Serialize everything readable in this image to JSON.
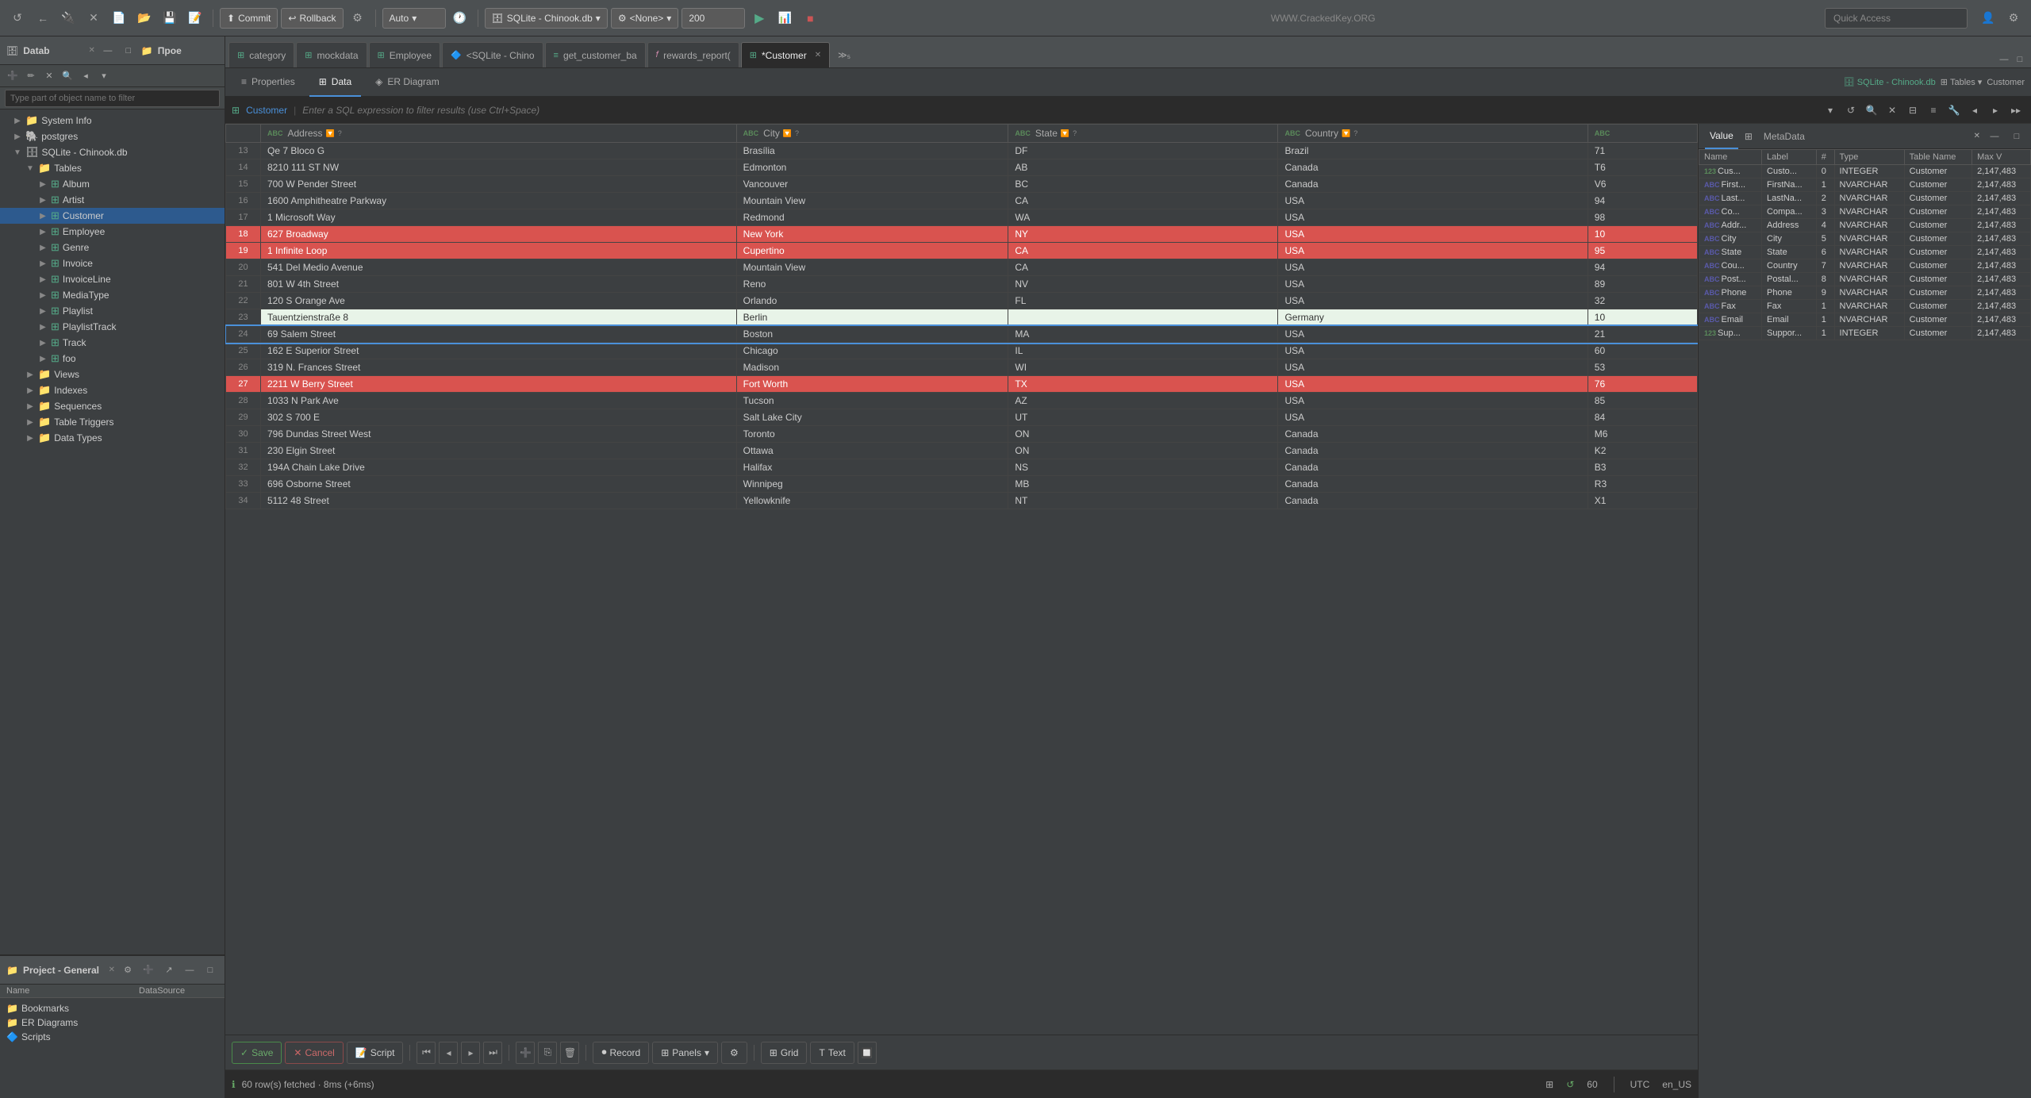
{
  "toolbar": {
    "commit_label": "Commit",
    "rollback_label": "Rollback",
    "auto_label": "Auto",
    "db_label": "SQLite - Chinook.db",
    "none_label": "<None>",
    "limit_value": "200",
    "quick_access_placeholder": "Quick Access",
    "url_text": "WWW.CrackedKey.ORG"
  },
  "sidebar": {
    "db_panel_title": "Datab",
    "proj_panel_title": "Прое",
    "filter_placeholder": "Type part of object name to filter",
    "tree_items": [
      {
        "label": "System Info",
        "indent": 1,
        "icon": "📁",
        "type": "folder"
      },
      {
        "label": "postgres",
        "indent": 1,
        "icon": "🐘",
        "type": "db"
      },
      {
        "label": "SQLite - Chinook.db",
        "indent": 1,
        "icon": "🗄",
        "type": "db",
        "expanded": true
      },
      {
        "label": "Tables",
        "indent": 2,
        "icon": "📁",
        "type": "folder",
        "expanded": true
      },
      {
        "label": "Album",
        "indent": 3,
        "icon": "⊞",
        "type": "table"
      },
      {
        "label": "Artist",
        "indent": 3,
        "icon": "⊞",
        "type": "table"
      },
      {
        "label": "Customer",
        "indent": 3,
        "icon": "⊞",
        "type": "table",
        "selected": true
      },
      {
        "label": "Employee",
        "indent": 3,
        "icon": "⊞",
        "type": "table"
      },
      {
        "label": "Genre",
        "indent": 3,
        "icon": "⊞",
        "type": "table"
      },
      {
        "label": "Invoice",
        "indent": 3,
        "icon": "⊞",
        "type": "table"
      },
      {
        "label": "InvoiceLine",
        "indent": 3,
        "icon": "⊞",
        "type": "table"
      },
      {
        "label": "MediaType",
        "indent": 3,
        "icon": "⊞",
        "type": "table"
      },
      {
        "label": "Playlist",
        "indent": 3,
        "icon": "⊞",
        "type": "table"
      },
      {
        "label": "PlaylistTrack",
        "indent": 3,
        "icon": "⊞",
        "type": "table"
      },
      {
        "label": "Track",
        "indent": 3,
        "icon": "⊞",
        "type": "table"
      },
      {
        "label": "foo",
        "indent": 3,
        "icon": "⊞",
        "type": "table"
      },
      {
        "label": "Views",
        "indent": 2,
        "icon": "📁",
        "type": "folder"
      },
      {
        "label": "Indexes",
        "indent": 2,
        "icon": "📁",
        "type": "folder"
      },
      {
        "label": "Sequences",
        "indent": 2,
        "icon": "📁",
        "type": "folder"
      },
      {
        "label": "Table Triggers",
        "indent": 2,
        "icon": "📁",
        "type": "folder"
      },
      {
        "label": "Data Types",
        "indent": 2,
        "icon": "📁",
        "type": "folder"
      }
    ]
  },
  "project": {
    "title": "Project - General",
    "col_name": "Name",
    "col_datasource": "DataSource",
    "items": [
      {
        "name": "Bookmarks",
        "icon": "📁",
        "color": "orange"
      },
      {
        "name": "ER Diagrams",
        "icon": "📁",
        "color": "orange"
      },
      {
        "name": "Scripts",
        "icon": "🔷",
        "color": "blue"
      }
    ]
  },
  "tabs": [
    {
      "label": "category",
      "icon": "⊞",
      "active": false
    },
    {
      "label": "mockdata",
      "icon": "⊞",
      "active": false
    },
    {
      "label": "Employee",
      "icon": "⊞",
      "active": false
    },
    {
      "label": "<SQLite - Chino",
      "icon": "🔷",
      "active": false
    },
    {
      "label": "get_customer_ba",
      "icon": "≡",
      "active": false
    },
    {
      "label": "rewards_report(",
      "icon": "𝑓",
      "active": false
    },
    {
      "label": "*Customer",
      "icon": "⊞",
      "active": true,
      "closeable": true
    }
  ],
  "editor_tabs": [
    {
      "label": "Properties",
      "icon": "≡",
      "active": false
    },
    {
      "label": "Data",
      "icon": "⊞",
      "active": true
    },
    {
      "label": "ER Diagram",
      "icon": "◈",
      "active": false
    }
  ],
  "breadcrumb": {
    "table_label": "Customer",
    "filter_placeholder": "Enter a SQL expression to filter results (use Ctrl+Space)",
    "db_info": "SQLite - Chinook.db",
    "tables_label": "Tables",
    "customer_label": "Customer"
  },
  "table": {
    "columns": [
      {
        "name": "Address",
        "type": "ABC"
      },
      {
        "name": "City",
        "type": "ABC"
      },
      {
        "name": "State",
        "type": "ABC"
      },
      {
        "name": "Country",
        "type": "ABC"
      }
    ],
    "rows": [
      {
        "num": 13,
        "address": "Qe 7 Bloco G",
        "city": "Brasília",
        "state": "DF",
        "country": "Brazil",
        "extra": "71",
        "selected": false
      },
      {
        "num": 14,
        "address": "8210 111 ST NW",
        "city": "Edmonton",
        "state": "AB",
        "country": "Canada",
        "extra": "T6",
        "selected": false
      },
      {
        "num": 15,
        "address": "700 W Pender Street",
        "city": "Vancouver",
        "state": "BC",
        "country": "Canada",
        "extra": "V6",
        "selected": false
      },
      {
        "num": 16,
        "address": "1600 Amphitheatre Parkway",
        "city": "Mountain View",
        "state": "CA",
        "country": "USA",
        "extra": "94",
        "selected": false
      },
      {
        "num": 17,
        "address": "1 Microsoft Way",
        "city": "Redmond",
        "state": "WA",
        "country": "USA",
        "extra": "98",
        "selected": false
      },
      {
        "num": 18,
        "address": "627 Broadway",
        "city": "New York",
        "state": "NY",
        "country": "USA",
        "extra": "10",
        "selected": true
      },
      {
        "num": 19,
        "address": "1 Infinite Loop",
        "city": "Cupertino",
        "state": "CA",
        "country": "USA",
        "extra": "95",
        "selected": true
      },
      {
        "num": 20,
        "address": "541 Del Medio Avenue",
        "city": "Mountain View",
        "state": "CA",
        "country": "USA",
        "extra": "94",
        "selected": false
      },
      {
        "num": 21,
        "address": "801 W 4th Street",
        "city": "Reno",
        "state": "NV",
        "country": "USA",
        "extra": "89",
        "selected": false
      },
      {
        "num": 22,
        "address": "120 S Orange Ave",
        "city": "Orlando",
        "state": "FL",
        "country": "USA",
        "extra": "32",
        "selected": false
      },
      {
        "num": 23,
        "address": "Tauentzienstraße 8",
        "city": "Berlin",
        "state": "",
        "country": "Germany",
        "extra": "10",
        "selected": false,
        "highlight": true
      },
      {
        "num": 24,
        "address": "69 Salem Street",
        "city": "Boston",
        "state": "MA",
        "country": "USA",
        "extra": "21",
        "selected": false,
        "border": true
      },
      {
        "num": 25,
        "address": "162 E Superior Street",
        "city": "Chicago",
        "state": "IL",
        "country": "USA",
        "extra": "60",
        "selected": false
      },
      {
        "num": 26,
        "address": "319 N. Frances Street",
        "city": "Madison",
        "state": "WI",
        "country": "USA",
        "extra": "53",
        "selected": false
      },
      {
        "num": 27,
        "address": "2211 W Berry Street",
        "city": "Fort Worth",
        "state": "TX",
        "country": "USA",
        "extra": "76",
        "selected": true
      },
      {
        "num": 28,
        "address": "1033 N Park Ave",
        "city": "Tucson",
        "state": "AZ",
        "country": "USA",
        "extra": "85",
        "selected": false
      },
      {
        "num": 29,
        "address": "302 S 700 E",
        "city": "Salt Lake City",
        "state": "UT",
        "country": "USA",
        "extra": "84",
        "selected": false
      },
      {
        "num": 30,
        "address": "796 Dundas Street West",
        "city": "Toronto",
        "state": "ON",
        "country": "Canada",
        "extra": "M6",
        "selected": false
      },
      {
        "num": 31,
        "address": "230 Elgin Street",
        "city": "Ottawa",
        "state": "ON",
        "country": "Canada",
        "extra": "K2",
        "selected": false
      },
      {
        "num": 32,
        "address": "194A Chain Lake Drive",
        "city": "Halifax",
        "state": "NS",
        "country": "Canada",
        "extra": "B3",
        "selected": false
      },
      {
        "num": 33,
        "address": "696 Osborne Street",
        "city": "Winnipeg",
        "state": "MB",
        "country": "Canada",
        "extra": "R3",
        "selected": false
      },
      {
        "num": 34,
        "address": "5112 48 Street",
        "city": "Yellowknife",
        "state": "NT",
        "country": "Canada",
        "extra": "X1",
        "selected": false
      }
    ]
  },
  "value_panel": {
    "value_tab": "Value",
    "metadata_tab": "MetaData",
    "columns": [
      "Name",
      "Label",
      "#",
      "Type",
      "Table Name",
      "Max V"
    ],
    "rows": [
      {
        "name": "123 Cus...",
        "label": "Custo...",
        "num": "0",
        "type": "INTEGER",
        "table": "Customer",
        "max": "2,147,483"
      },
      {
        "name": "ABC First...",
        "label": "FirstNa...",
        "num": "1",
        "type": "NVARCHAR",
        "table": "Customer",
        "max": "2,147,483"
      },
      {
        "name": "ABC Last...",
        "label": "LastNa...",
        "num": "2",
        "type": "NVARCHAR",
        "table": "Customer",
        "max": "2,147,483"
      },
      {
        "name": "ABC Co...",
        "label": "Compa...",
        "num": "3",
        "type": "NVARCHAR",
        "table": "Customer",
        "max": "2,147,483"
      },
      {
        "name": "ABC Addr...",
        "label": "Address",
        "num": "4",
        "type": "NVARCHAR",
        "table": "Customer",
        "max": "2,147,483"
      },
      {
        "name": "ABC City",
        "label": "City",
        "num": "5",
        "type": "NVARCHAR",
        "table": "Customer",
        "max": "2,147,483"
      },
      {
        "name": "ABC State",
        "label": "State",
        "num": "6",
        "type": "NVARCHAR",
        "table": "Customer",
        "max": "2,147,483"
      },
      {
        "name": "ABC Cou...",
        "label": "Country",
        "num": "7",
        "type": "NVARCHAR",
        "table": "Customer",
        "max": "2,147,483"
      },
      {
        "name": "ABC Post...",
        "label": "Postal...",
        "num": "8",
        "type": "NVARCHAR",
        "table": "Customer",
        "max": "2,147,483"
      },
      {
        "name": "ABC Phone",
        "label": "Phone",
        "num": "9",
        "type": "NVARCHAR",
        "table": "Customer",
        "max": "2,147,483"
      },
      {
        "name": "ABC Fax",
        "label": "Fax",
        "num": "1",
        "type": "NVARCHAR",
        "table": "Customer",
        "max": "2,147,483"
      },
      {
        "name": "ABC Email",
        "label": "Email",
        "num": "1",
        "type": "NVARCHAR",
        "table": "Customer",
        "max": "2,147,483"
      },
      {
        "name": "123 Sup...",
        "label": "Suppor...",
        "num": "1",
        "type": "INTEGER",
        "table": "Customer",
        "max": "2,147,483"
      }
    ]
  },
  "bottom_bar": {
    "save_label": "Save",
    "cancel_label": "Cancel",
    "script_label": "Script",
    "record_label": "Record",
    "panels_label": "Panels",
    "grid_label": "Grid",
    "text_label": "Text"
  },
  "status_bar": {
    "info": "60 row(s) fetched · 8ms (+6ms)",
    "count": "60",
    "locale": "en_US",
    "timezone": "UTC"
  }
}
